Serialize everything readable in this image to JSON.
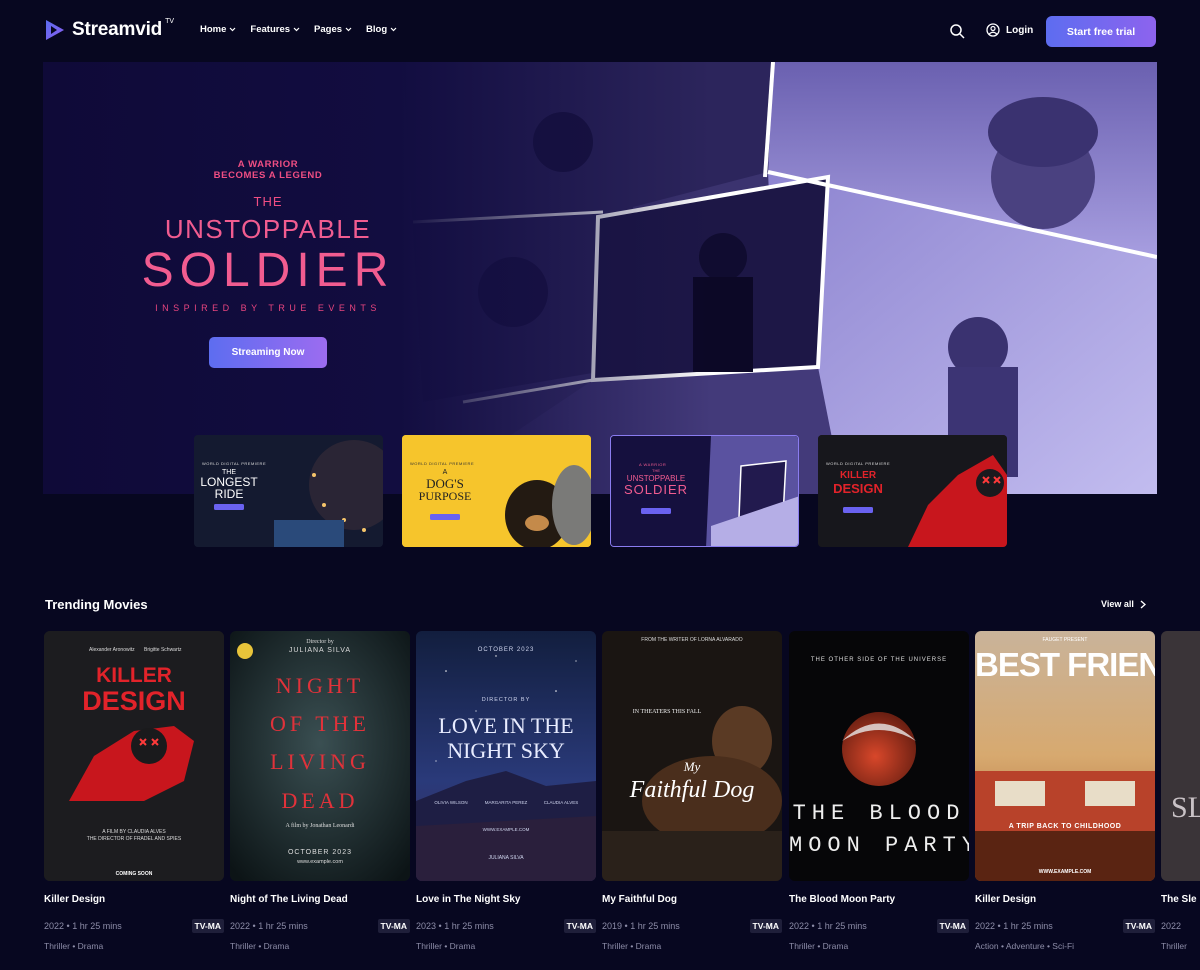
{
  "header": {
    "logo": "Streamvid",
    "logo_sup": "TV",
    "nav": [
      {
        "label": "Home"
      },
      {
        "label": "Features"
      },
      {
        "label": "Pages"
      },
      {
        "label": "Blog"
      }
    ],
    "login": "Login",
    "cta": "Start free trial"
  },
  "hero": {
    "tagline_1": "A WARRIOR",
    "tagline_2": "BECOMES A LEGEND",
    "the": "THE",
    "title_1": "UNSTOPPABLE",
    "title_2": "SOLDIER",
    "subtitle": "INSPIRED BY TRUE EVENTS",
    "button": "Streaming Now"
  },
  "thumbs": [
    {
      "label": "WORLD DIGITAL PREMIERE",
      "title_1": "THE",
      "title_2": "LONGEST",
      "title_3": "RIDE"
    },
    {
      "label": "WORLD DIGITAL PREMIERE",
      "title_1": "A",
      "title_2": "DOG'S",
      "title_3": "PURPOSE"
    },
    {
      "label": "A WARRIOR",
      "title_1": "THE",
      "title_2": "UNSTOPPABLE",
      "title_3": "SOLDIER"
    },
    {
      "label": "WORLD DIGITAL PREMIERE",
      "title_1": "KILLER",
      "title_2": "DESIGN",
      "title_3": ""
    }
  ],
  "trending": {
    "title": "Trending Movies",
    "view_all": "View all",
    "movies": [
      {
        "title": "Killer Design",
        "year": "2022",
        "duration": "1 hr 25 mins",
        "rating": "TV-MA",
        "genres": "Thriller  •  Drama",
        "poster": {
          "names_1": "Alexander Aronowitz",
          "names_2": "Brigitte Schwartz",
          "t1": "KILLER",
          "t2": "DESIGN",
          "credit_1": "A FILM BY CLAUDIA ALVES",
          "credit_2": "THE DIRECTOR OF FRADEL AND SPIES",
          "footer": "COMING SOON"
        }
      },
      {
        "title": "Night of The Living Dead",
        "year": "2022",
        "duration": "1 hr 25 mins",
        "rating": "TV-MA",
        "genres": "Thriller  •  Drama",
        "poster": {
          "director_1": "Director by",
          "director_2": "JULIANA SILVA",
          "t1": "NIGHT",
          "t2": "OF THE",
          "t3": "LIVING",
          "t4": "DEAD",
          "credit": "A film by Jonathan Leonardi",
          "date": "OCTOBER 2023",
          "url": "www.example.com"
        }
      },
      {
        "title": "Love in The Night Sky",
        "year": "2023",
        "duration": "1 hr 25 mins",
        "rating": "TV-MA",
        "genres": "Thriller  •  Drama",
        "poster": {
          "date": "OCTOBER 2023",
          "director": "DIRECTOR BY",
          "t1": "LOVE IN THE",
          "t2": "NIGHT SKY",
          "cast_1": "OLIVIA WILSON",
          "cast_2": "MARGARITA PEREZ",
          "cast_3": "CLAUDIA ALVES",
          "url": "WWW.EXAMPLE.COM",
          "footer": "JULIANA SILVA"
        }
      },
      {
        "title": "My Faithful Dog",
        "year": "2019",
        "duration": "1 hr 25 mins",
        "rating": "TV-MA",
        "genres": "Thriller  •  Drama",
        "poster": {
          "top": "FROM THE WRITER OF LORNA ALVARADO",
          "release": "IN THEATERS THIS FALL",
          "t1": "My",
          "t2": "Faithful Dog"
        }
      },
      {
        "title": "The Blood Moon Party",
        "year": "2022",
        "duration": "1 hr 25 mins",
        "rating": "TV-MA",
        "genres": "Thriller  •  Drama",
        "poster": {
          "top": "THE OTHER SIDE OF THE UNIVERSE",
          "t1": "THE BLOOD",
          "t2": "MOON PARTY"
        }
      },
      {
        "title": "Killer Design",
        "year": "2022",
        "duration": "1 hr 25 mins",
        "rating": "TV-MA",
        "genres": "Action  •  Adventure  •  Sci-Fi",
        "poster": {
          "top": "FAUGET PRESENT",
          "t1": "BEST FRIEND",
          "sub": "A TRIP BACK TO CHILDHOOD",
          "url": "WWW.EXAMPLE.COM"
        }
      },
      {
        "title": "The Sle",
        "year": "2022",
        "duration": "",
        "rating": "",
        "genres": "Thriller",
        "poster": {
          "t1": "SL"
        }
      }
    ]
  },
  "colors": {
    "background": "#070720",
    "accent": "#6b66f0",
    "hero_pink": "#f15c90"
  }
}
